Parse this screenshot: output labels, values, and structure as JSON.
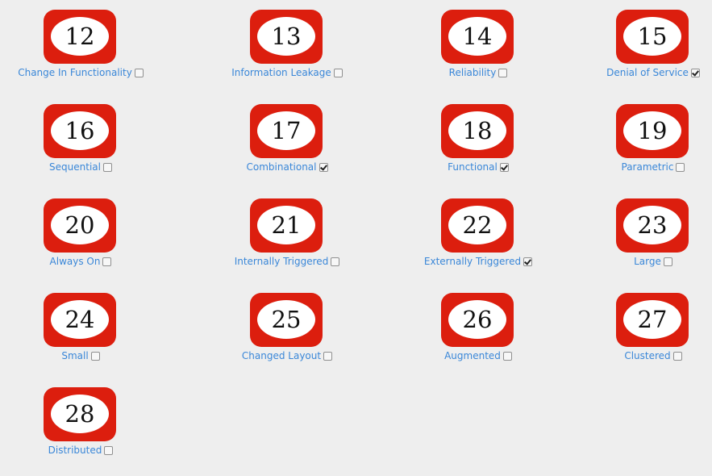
{
  "items": [
    {
      "number": "12",
      "label": "Change In Functionality",
      "checked": false
    },
    {
      "number": "13",
      "label": "Information Leakage",
      "checked": false
    },
    {
      "number": "14",
      "label": "Reliability",
      "checked": false
    },
    {
      "number": "15",
      "label": "Denial of Service",
      "checked": true
    },
    {
      "number": "16",
      "label": "Sequential",
      "checked": false
    },
    {
      "number": "17",
      "label": "Combinational",
      "checked": true
    },
    {
      "number": "18",
      "label": "Functional",
      "checked": true
    },
    {
      "number": "19",
      "label": "Parametric",
      "checked": false
    },
    {
      "number": "20",
      "label": "Always On",
      "checked": false
    },
    {
      "number": "21",
      "label": "Internally Triggered",
      "checked": false
    },
    {
      "number": "22",
      "label": "Externally Triggered",
      "checked": true
    },
    {
      "number": "23",
      "label": "Large",
      "checked": false
    },
    {
      "number": "24",
      "label": "Small",
      "checked": false
    },
    {
      "number": "25",
      "label": "Changed Layout",
      "checked": false
    },
    {
      "number": "26",
      "label": "Augmented",
      "checked": false
    },
    {
      "number": "27",
      "label": "Clustered",
      "checked": false
    },
    {
      "number": "28",
      "label": "Distributed",
      "checked": false
    }
  ],
  "colors": {
    "badge": "#dc1e0e",
    "label": "#3a87d8",
    "background": "#eeeeee"
  }
}
